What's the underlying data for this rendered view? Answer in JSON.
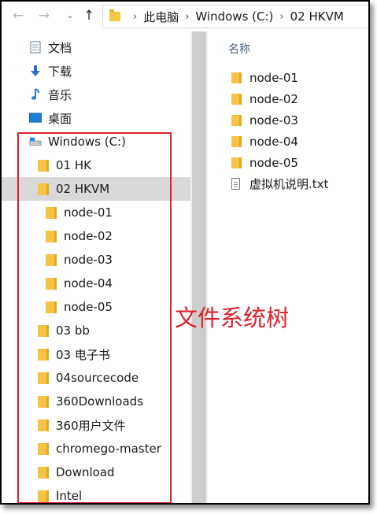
{
  "toolbar": {
    "back": "←",
    "forward": "→",
    "dropdown": "⌄",
    "up": "↑",
    "crumbs": [
      "此电脑",
      "Windows (C:)",
      "02 HKVM"
    ],
    "crumb_separator": "›"
  },
  "nav": {
    "quick_access": [
      {
        "label": "文档",
        "icon": "document-icon"
      },
      {
        "label": "下载",
        "icon": "download-icon"
      },
      {
        "label": "音乐",
        "icon": "music-icon"
      },
      {
        "label": "桌面",
        "icon": "desktop-icon"
      }
    ],
    "drive": {
      "label": "Windows (C:)",
      "icon": "drive-icon"
    },
    "folders": [
      {
        "label": "01 HK",
        "level": 1
      },
      {
        "label": "02 HKVM",
        "level": 1,
        "selected": true
      },
      {
        "label": "node-01",
        "level": 2
      },
      {
        "label": "node-02",
        "level": 2
      },
      {
        "label": "node-03",
        "level": 2
      },
      {
        "label": "node-04",
        "level": 2
      },
      {
        "label": "node-05",
        "level": 2
      },
      {
        "label": "03 bb",
        "level": 1
      },
      {
        "label": "03 电子书",
        "level": 1
      },
      {
        "label": "04sourcecode",
        "level": 1
      },
      {
        "label": "360Downloads",
        "level": 1
      },
      {
        "label": "360用户文件",
        "level": 1
      },
      {
        "label": "chromego-master",
        "level": 1
      },
      {
        "label": "Download",
        "level": 1
      },
      {
        "label": "Intel",
        "level": 1
      }
    ]
  },
  "content": {
    "column_name": "名称",
    "items": [
      {
        "label": "node-01",
        "type": "folder"
      },
      {
        "label": "node-02",
        "type": "folder"
      },
      {
        "label": "node-03",
        "type": "folder"
      },
      {
        "label": "node-04",
        "type": "folder"
      },
      {
        "label": "node-05",
        "type": "folder"
      },
      {
        "label": "虚拟机说明.txt",
        "type": "txt"
      }
    ]
  },
  "annotation": {
    "text": "文件系统树",
    "color": "#e0202a"
  },
  "colors": {
    "folder": "#f6c344",
    "selected_row": "#d9d9d9",
    "header_text": "#4c607a"
  }
}
